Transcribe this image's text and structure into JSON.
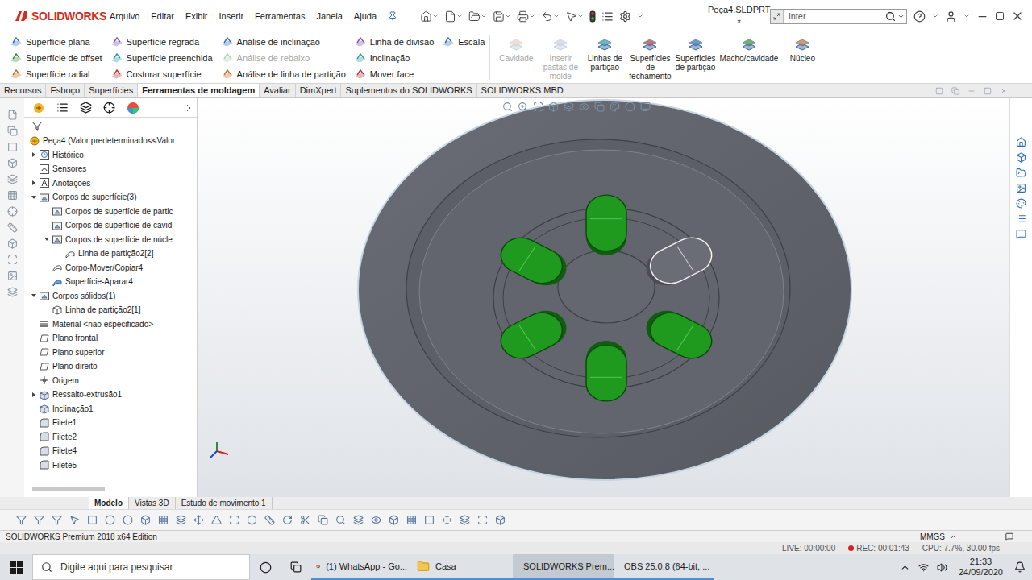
{
  "app": {
    "logo": "SOLIDWORKS",
    "title": "Peça4.SLDPRT *",
    "search": "inter"
  },
  "menu": [
    "Arquivo",
    "Editar",
    "Exibir",
    "Inserir",
    "Ferramentas",
    "Janela",
    "Ajuda"
  ],
  "ribbon": {
    "columns": [
      [
        {
          "label": "Superfície plana",
          "disabled": false
        },
        {
          "label": "Superfície de offset",
          "disabled": false
        },
        {
          "label": "Superfície radial",
          "disabled": false
        }
      ],
      [
        {
          "label": "Superfície regrada",
          "disabled": false
        },
        {
          "label": "Superfície preenchida",
          "disabled": false
        },
        {
          "label": "Costurar superfície",
          "disabled": false
        }
      ],
      [
        {
          "label": "Análise de inclinação",
          "disabled": false
        },
        {
          "label": "Análise de rebaixo",
          "disabled": true
        },
        {
          "label": "Análise de linha de partição",
          "disabled": false
        }
      ],
      [
        {
          "label": "Linha de divisão",
          "disabled": false
        },
        {
          "label": "Inclinação",
          "disabled": false
        },
        {
          "label": "Mover face",
          "disabled": false
        }
      ],
      [
        {
          "label": "Escala",
          "disabled": false
        }
      ]
    ],
    "large": [
      {
        "label": "Cavidade",
        "disabled": true
      },
      {
        "label": "Inserir pastas de molde",
        "disabled": true
      },
      {
        "label": "Linhas de partição",
        "disabled": false
      },
      {
        "label": "Superfícies de fechamento",
        "disabled": false
      },
      {
        "label": "Superfícies de partição",
        "disabled": false
      },
      {
        "label": "Macho/cavidade",
        "disabled": false
      },
      {
        "label": "Núcleo",
        "disabled": false
      }
    ]
  },
  "tabs": [
    {
      "label": "Recursos",
      "selected": false
    },
    {
      "label": "Esboço",
      "selected": false
    },
    {
      "label": "Superfícies",
      "selected": false
    },
    {
      "label": "Ferramentas de moldagem",
      "selected": true
    },
    {
      "label": "Avaliar",
      "selected": false
    },
    {
      "label": "DimXpert",
      "selected": false
    },
    {
      "label": "Suplementos do SOLIDWORKS",
      "selected": false
    },
    {
      "label": "SOLIDWORKS MBD",
      "selected": false
    }
  ],
  "tree": {
    "root": "Peça4 (Valor predeterminado<<Valor",
    "items": [
      {
        "label": "Histórico",
        "depth": 0,
        "has_children": true,
        "expanded": false,
        "kind": "history"
      },
      {
        "label": "Sensores",
        "depth": 0,
        "has_children": false,
        "expanded": false,
        "kind": "sensor"
      },
      {
        "label": "Anotações",
        "depth": 0,
        "has_children": true,
        "expanded": false,
        "kind": "annotation"
      },
      {
        "label": "Corpos de superfície(3)",
        "depth": 0,
        "has_children": true,
        "expanded": true,
        "kind": "bodies"
      },
      {
        "label": "Corpos de superfície de partic",
        "depth": 1,
        "has_children": false,
        "expanded": false,
        "kind": "bodies"
      },
      {
        "label": "Corpos de superfície de cavid",
        "depth": 1,
        "has_children": false,
        "expanded": false,
        "kind": "bodies"
      },
      {
        "label": "Corpos de superfície de núcle",
        "depth": 1,
        "has_children": true,
        "expanded": true,
        "kind": "bodies"
      },
      {
        "label": "Linha de partição2[2]",
        "depth": 2,
        "has_children": false,
        "expanded": false,
        "kind": "surface"
      },
      {
        "label": "Corpo-Mover/Copiar4",
        "depth": 1,
        "has_children": false,
        "expanded": false,
        "kind": "surface"
      },
      {
        "label": "Superfície-Aparar4",
        "depth": 1,
        "has_children": false,
        "expanded": false,
        "kind": "trim"
      },
      {
        "label": "Corpos sólidos(1)",
        "depth": 0,
        "has_children": true,
        "expanded": true,
        "kind": "bodies"
      },
      {
        "label": "Linha de partição2[1]",
        "depth": 1,
        "has_children": false,
        "expanded": false,
        "kind": "solid"
      },
      {
        "label": "Material <não especificado>",
        "depth": 0,
        "has_children": false,
        "expanded": false,
        "kind": "material"
      },
      {
        "label": "Plano frontal",
        "depth": 0,
        "has_children": false,
        "expanded": false,
        "kind": "plane"
      },
      {
        "label": "Plano superior",
        "depth": 0,
        "has_children": false,
        "expanded": false,
        "kind": "plane"
      },
      {
        "label": "Plano direito",
        "depth": 0,
        "has_children": false,
        "expanded": false,
        "kind": "plane"
      },
      {
        "label": "Origem",
        "depth": 0,
        "has_children": false,
        "expanded": false,
        "kind": "origin"
      },
      {
        "label": "Ressalto-extrusão1",
        "depth": 0,
        "has_children": true,
        "expanded": false,
        "kind": "feature"
      },
      {
        "label": "Inclinação1",
        "depth": 0,
        "has_children": false,
        "expanded": false,
        "kind": "feature"
      },
      {
        "label": "Filete1",
        "depth": 0,
        "has_children": false,
        "expanded": false,
        "kind": "fillet"
      },
      {
        "label": "Filete2",
        "depth": 0,
        "has_children": false,
        "expanded": false,
        "kind": "fillet"
      },
      {
        "label": "Filete4",
        "depth": 0,
        "has_children": false,
        "expanded": false,
        "kind": "fillet"
      },
      {
        "label": "Filete5",
        "depth": 0,
        "has_children": false,
        "expanded": false,
        "kind": "fillet"
      }
    ]
  },
  "model": {
    "slots": [
      {
        "selected": true
      },
      {
        "selected": false
      },
      {
        "selected": true
      },
      {
        "selected": true
      },
      {
        "selected": true
      },
      {
        "selected": true
      }
    ]
  },
  "bottom_tabs": [
    {
      "label": "Modelo",
      "selected": true
    },
    {
      "label": "Vistas 3D",
      "selected": false
    },
    {
      "label": "Estudo de movimento 1",
      "selected": false
    }
  ],
  "status_bar": {
    "edition": "SOLIDWORKS Premium 2018 x64 Edition",
    "units": "MMGS"
  },
  "recorder": {
    "live": "LIVE: 00:00:00",
    "rec": "REC: 00:01:43",
    "cpu": "CPU: 7.7%, 30.00 fps"
  },
  "taskbar": {
    "search": "Digite aqui para pesquisar",
    "apps": [
      {
        "label": "(1) WhatsApp - Go...",
        "kind": "chrome",
        "selected": false
      },
      {
        "label": "Casa",
        "kind": "folder",
        "selected": false
      },
      {
        "label": "SOLIDWORKS Prem...",
        "kind": "solidworks",
        "selected": true
      },
      {
        "label": "OBS 25.0.8 (64-bit, ...",
        "kind": "obs",
        "selected": false
      }
    ],
    "time": "21:33",
    "date": "24/09/2020"
  }
}
